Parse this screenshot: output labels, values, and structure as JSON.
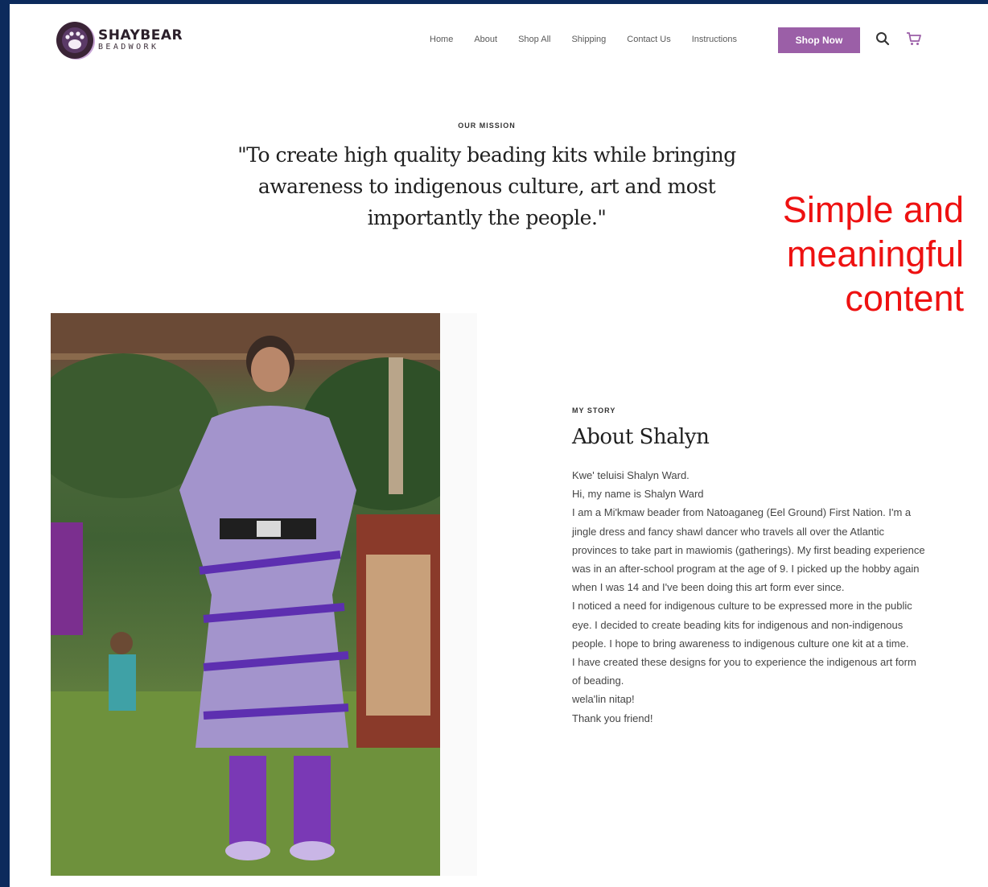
{
  "brand": {
    "name": "SHAYBEAR",
    "sub": "BEADWORK"
  },
  "nav": {
    "items": [
      "Home",
      "About",
      "Shop All",
      "Shipping",
      "Contact Us",
      "Instructions"
    ],
    "cta_label": "Shop Now",
    "icons": [
      "search-icon",
      "cart-icon"
    ]
  },
  "mission": {
    "eyebrow": "OUR MISSION",
    "quote": "\"To create high quality beading kits while bringing awareness to indigenous culture, art and most importantly the people.\""
  },
  "annotation": {
    "text": "Simple and meaningful content",
    "color": "#ee1111"
  },
  "story": {
    "eyebrow": "MY STORY",
    "title": "About Shalyn",
    "lines": [
      "Kwe' teluisi Shalyn Ward.",
      "Hi, my name is Shalyn Ward",
      "I am a Mi'kmaw beader from Natoaganeg (Eel Ground) First Nation. I'm a jingle dress and fancy shawl dancer who travels all over the Atlantic provinces to take part in mawiomis (gatherings). My first beading experience was in an after-school program at the age of 9. I picked up the hobby again when I was 14 and I've been doing this art form ever since.",
      "I noticed a need for indigenous culture to be expressed more in the public eye. I decided to create beading kits for indigenous and non-indigenous people. I hope to bring awareness to indigenous culture one kit at a time.",
      "I have created these designs for you to experience the indigenous art form of beading.",
      " wela'lin nitap!",
      "Thank you friend!"
    ]
  },
  "colors": {
    "accent": "#9b5fa7",
    "frame": "#0c2a5c"
  }
}
